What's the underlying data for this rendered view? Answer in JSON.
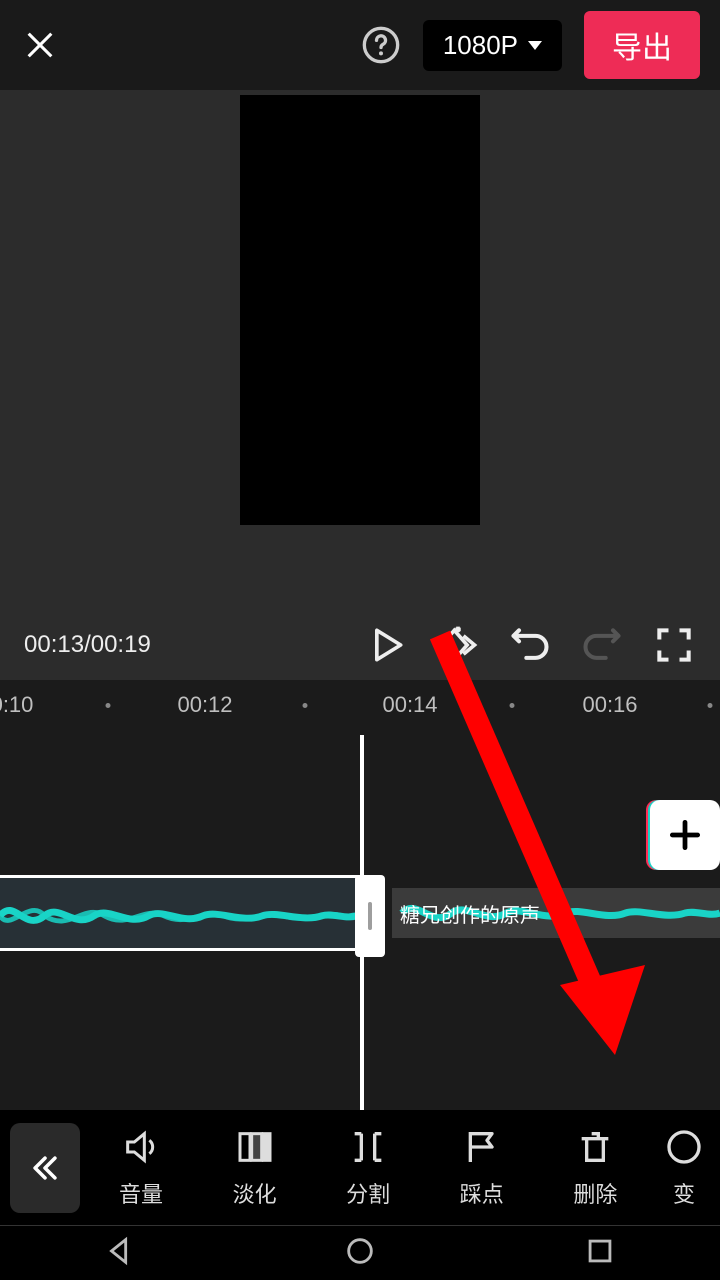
{
  "header": {
    "resolution": "1080P",
    "export_label": "导出"
  },
  "player": {
    "current": "00:13",
    "total": "00:19"
  },
  "timeline": {
    "ticks": [
      "0:10",
      "00:12",
      "00:14",
      "00:16"
    ],
    "clip_label": "糖兄创作的原声"
  },
  "tools": {
    "volume": "音量",
    "fade": "淡化",
    "split": "分割",
    "beat": "踩点",
    "delete": "删除",
    "change": "变"
  }
}
